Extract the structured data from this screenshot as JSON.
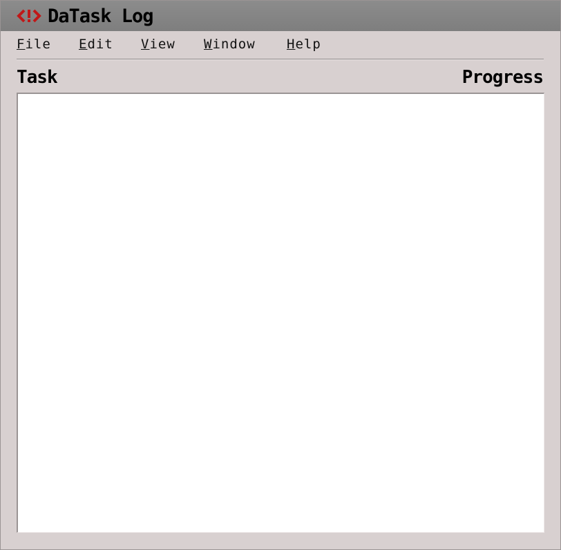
{
  "window": {
    "title": "DaTask Log",
    "icon": "exclamation-brackets-icon",
    "icon_color": "#c01818"
  },
  "menu": {
    "items": [
      {
        "mnemonic": "F",
        "rest": "ile"
      },
      {
        "mnemonic": "E",
        "rest": "dit"
      },
      {
        "mnemonic": "V",
        "rest": "iew"
      },
      {
        "mnemonic": "W",
        "rest": "indow"
      },
      {
        "mnemonic": "H",
        "rest": "elp"
      }
    ]
  },
  "list": {
    "columns": {
      "task": "Task",
      "progress": "Progress"
    },
    "rows": []
  }
}
